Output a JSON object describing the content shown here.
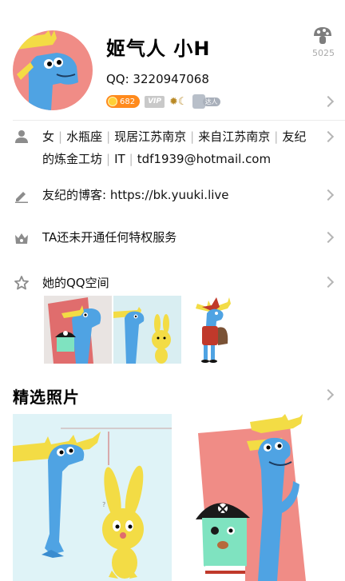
{
  "profile": {
    "name": "姬气人 小H",
    "qq": "QQ: 3220947068",
    "likes": "5025",
    "badges": {
      "coin": "682",
      "vip": "VIP",
      "sym": "✹☾",
      "da": "达人"
    }
  },
  "info": {
    "items": [
      "女",
      "水瓶座",
      "现居江苏南京",
      "来自江苏南京",
      "友纪的炼金工坊",
      "IT",
      "tdf1939@hotmail.com"
    ]
  },
  "blog": {
    "label": "友纪的博客: https://bk.yuuki.live"
  },
  "privilege": {
    "label": "TA还未开通任何特权服务"
  },
  "qzone": {
    "label": "她的QQ空间"
  },
  "photos": {
    "title": "精选照片"
  },
  "icons": {
    "person": "person-icon",
    "pen": "pen-icon",
    "crown": "crown-icon",
    "star": "star-icon",
    "mushroom": "mushroom-icon"
  },
  "colors": {
    "accent_orange": "#ff8a1c",
    "icon_gray": "#8c8c8c",
    "moose_blue": "#4a9fe0",
    "antler_yellow": "#f5dc4a"
  }
}
